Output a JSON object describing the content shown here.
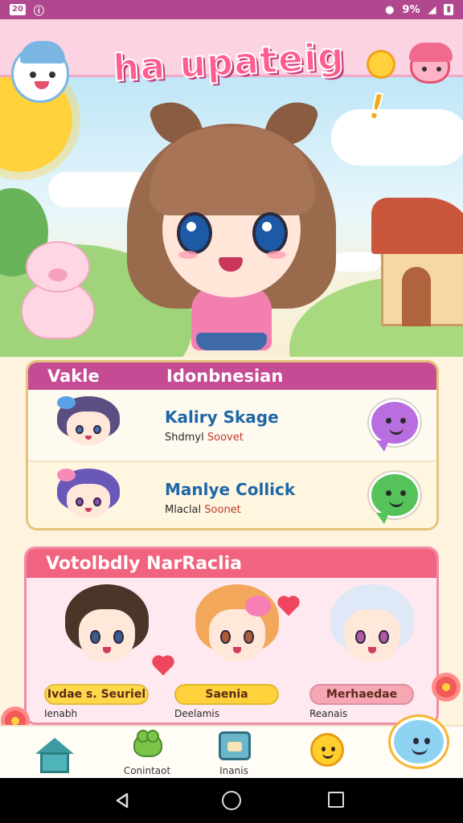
{
  "status_bar": {
    "time": "20",
    "badge": "ⓘ",
    "battery_label": "9%"
  },
  "header": {
    "title": "ha upateig",
    "exclaim": "!"
  },
  "language_card": {
    "col1": "Vakle",
    "col2": "Idonbnesian",
    "rows": [
      {
        "name": "Kaliry Skage",
        "sub_a": "Shdmyl",
        "sub_b": "Soovet",
        "chat_color": "#b86ee0"
      },
      {
        "name": "Manlye Collick",
        "sub_a": "Mlaclal",
        "sub_b": "Soonet",
        "chat_color": "#55c25a"
      }
    ]
  },
  "friends": {
    "title": "Votolbdly NarRaclia",
    "items": [
      {
        "pill": "Ivdae s. Seuriel",
        "caption": "Ienabh",
        "pill_color": "#ffd84a"
      },
      {
        "pill": "Saenia",
        "caption": "Deelamis",
        "pill_color": "#ffd23c"
      },
      {
        "pill": "Merhaedae",
        "caption": "Reanais",
        "pill_color": "#f7a7b4"
      }
    ]
  },
  "bottom_nav": {
    "items": [
      {
        "label": "",
        "icon": "home-icon"
      },
      {
        "label": "Conintaot",
        "icon": "frog-icon"
      },
      {
        "label": "Inanis",
        "icon": "tv-icon"
      },
      {
        "label": "",
        "icon": "sun-icon"
      }
    ]
  },
  "colors": {
    "accent": "#c64b95",
    "friends_accent": "#f2637f",
    "status_bar": "#b1478e"
  }
}
